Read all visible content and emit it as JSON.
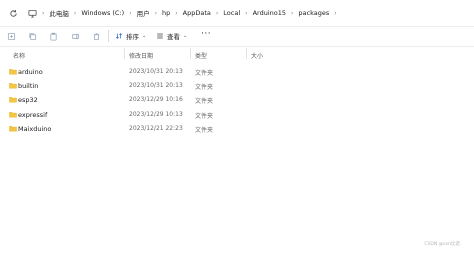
{
  "breadcrumb": [
    "此电脑",
    "Windows (C:)",
    "用户",
    "hp",
    "AppData",
    "Local",
    "Arduino15",
    "packages"
  ],
  "toolbar": {
    "sort_label": "排序",
    "view_label": "查看",
    "more_label": "···"
  },
  "columns": {
    "name": "名称",
    "date": "修改日期",
    "type": "类型",
    "size": "大小"
  },
  "rows": [
    {
      "name": "arduino",
      "date": "2023/10/31 20:13",
      "type": "文件夹"
    },
    {
      "name": "builtin",
      "date": "2023/10/31 20:13",
      "type": "文件夹"
    },
    {
      "name": "esp32",
      "date": "2023/12/29 10:16",
      "type": "文件夹"
    },
    {
      "name": "expressif",
      "date": "2023/12/29 10:13",
      "type": "文件夹"
    },
    {
      "name": "Maixduino",
      "date": "2023/12/21 22:23",
      "type": "文件夹"
    }
  ],
  "watermark": "CSDN @zxn比诺",
  "colors": {
    "folder": "#f4c542",
    "folder_tab": "#e0ac25",
    "accent": "#2a66c8"
  }
}
